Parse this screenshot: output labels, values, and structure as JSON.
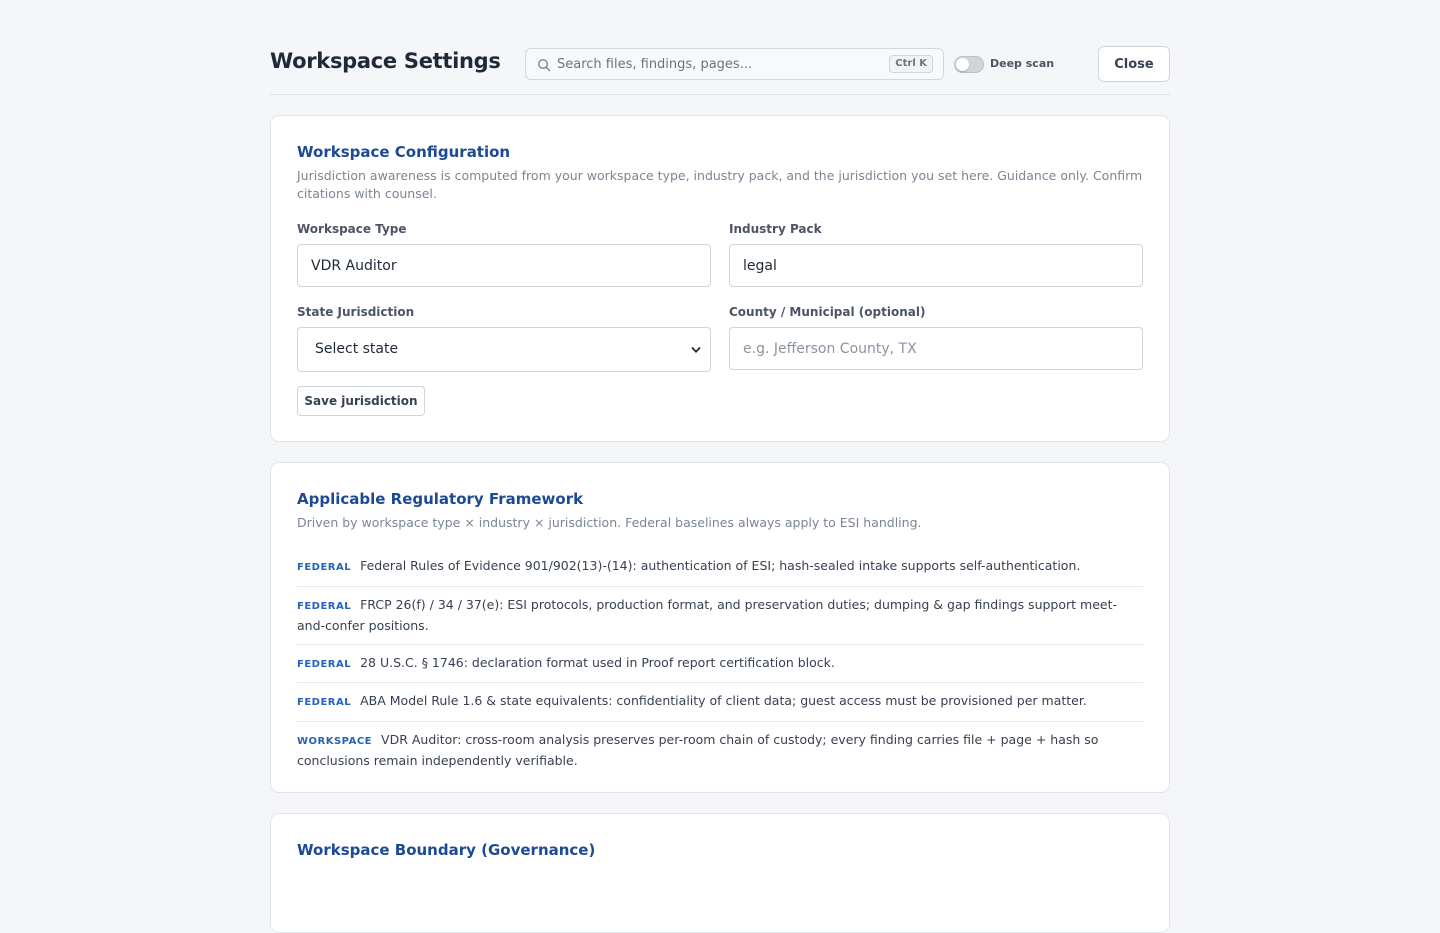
{
  "header": {
    "title": "Workspace Settings",
    "search_placeholder": "Search files, findings, pages...",
    "search_shortcut": "Ctrl K",
    "deep_scan_label": "Deep scan",
    "deep_scan_enabled": false,
    "close_label": "Close"
  },
  "config": {
    "title": "Workspace Configuration",
    "description": "Jurisdiction awareness is computed from your workspace type, industry pack, and the jurisdiction you set here. Guidance only. Confirm citations with counsel.",
    "workspace_type_label": "Workspace Type",
    "workspace_type_value": "VDR Auditor",
    "industry_pack_label": "Industry Pack",
    "industry_pack_value": "legal",
    "state_label": "State Jurisdiction",
    "state_value": "Select state",
    "county_label": "County / Municipal (optional)",
    "county_placeholder": "e.g. Jefferson County, TX",
    "save_label": "Save jurisdiction"
  },
  "framework": {
    "title": "Applicable Regulatory Framework",
    "description": "Driven by workspace type × industry × jurisdiction. Federal baselines always apply to ESI handling.",
    "items": [
      {
        "tag": "FEDERAL",
        "text": "Federal Rules of Evidence 901/902(13)-(14): authentication of ESI; hash-sealed intake supports self-authentication."
      },
      {
        "tag": "FEDERAL",
        "text": "FRCP 26(f) / 34 / 37(e): ESI protocols, production format, and preservation duties; dumping & gap findings support meet-and-confer positions."
      },
      {
        "tag": "FEDERAL",
        "text": "28 U.S.C. § 1746: declaration format used in Proof report certification block."
      },
      {
        "tag": "FEDERAL",
        "text": "ABA Model Rule 1.6 & state equivalents: confidentiality of client data; guest access must be provisioned per matter."
      },
      {
        "tag": "WORKSPACE",
        "text": "VDR Auditor: cross-room analysis preserves per-room chain of custody; every finding carries file + page + hash so conclusions remain independently verifiable."
      }
    ]
  },
  "boundary": {
    "title": "Workspace Boundary (Governance)"
  },
  "colors": {
    "accent": "#1d4a94",
    "tag": "#2563b8",
    "background": "#f4f6f9"
  }
}
